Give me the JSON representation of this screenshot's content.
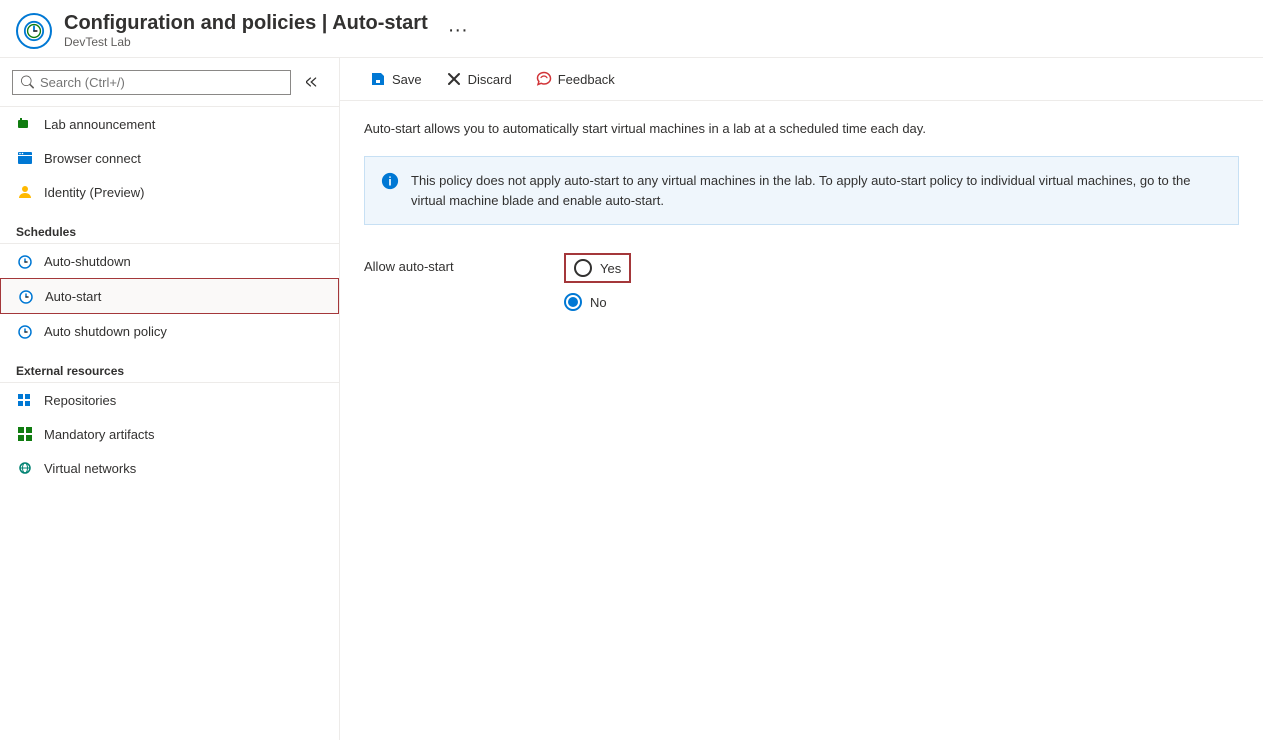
{
  "header": {
    "title": "Configuration and policies | Auto-start",
    "subtitle": "DevTest Lab",
    "dots": "···"
  },
  "search": {
    "placeholder": "Search (Ctrl+/)"
  },
  "toolbar": {
    "save_label": "Save",
    "discard_label": "Discard",
    "feedback_label": "Feedback"
  },
  "sidebar": {
    "items": [
      {
        "id": "lab-announcement",
        "label": "Lab announcement",
        "icon": "announcement"
      },
      {
        "id": "browser-connect",
        "label": "Browser connect",
        "icon": "browser"
      },
      {
        "id": "identity",
        "label": "Identity (Preview)",
        "icon": "identity"
      }
    ],
    "schedules_section": "Schedules",
    "schedule_items": [
      {
        "id": "auto-shutdown",
        "label": "Auto-shutdown",
        "icon": "clock"
      },
      {
        "id": "auto-start",
        "label": "Auto-start",
        "icon": "clock",
        "active": true
      },
      {
        "id": "auto-shutdown-policy",
        "label": "Auto shutdown policy",
        "icon": "clock"
      }
    ],
    "external_resources_section": "External resources",
    "external_items": [
      {
        "id": "repositories",
        "label": "Repositories",
        "icon": "repo"
      },
      {
        "id": "mandatory-artifacts",
        "label": "Mandatory artifacts",
        "icon": "artifacts"
      },
      {
        "id": "virtual-networks",
        "label": "Virtual networks",
        "icon": "network"
      }
    ]
  },
  "content": {
    "description": "Auto-start allows you to automatically start virtual machines in a lab at a scheduled time each day.",
    "info_banner": "This policy does not apply auto-start to any virtual machines in the lab. To apply auto-start policy to individual virtual machines, go to the virtual machine blade and enable auto-start.",
    "form_label": "Allow auto-start",
    "radio_yes": "Yes",
    "radio_no": "No",
    "radio_selected": "no"
  }
}
